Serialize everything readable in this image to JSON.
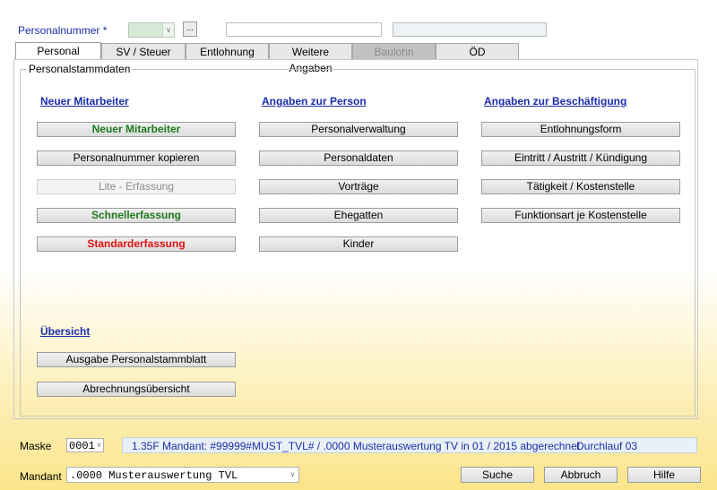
{
  "header": {
    "personalnummer_label": "Personalnummer *",
    "dots_label": "..."
  },
  "tabs": [
    {
      "label": "Personal",
      "state": "active"
    },
    {
      "label": "SV / Steuer",
      "state": "normal"
    },
    {
      "label": "Entlohnung",
      "state": "normal"
    },
    {
      "label": "Weitere Angaben",
      "state": "normal"
    },
    {
      "label": "Baulohn",
      "state": "disabled"
    },
    {
      "label": "ÖD",
      "state": "normal"
    }
  ],
  "group_title": "Personalstammdaten",
  "sections": {
    "neuer": {
      "heading": "Neuer Mitarbeiter",
      "buttons": [
        {
          "label": "Neuer Mitarbeiter"
        },
        {
          "label": "Personalnummer kopieren"
        },
        {
          "label": "Lite - Erfassung"
        },
        {
          "label": "Schnellerfassung"
        },
        {
          "label": "Standarderfassung"
        }
      ]
    },
    "person": {
      "heading": "Angaben zur Person",
      "buttons": [
        {
          "label": "Personalverwaltung"
        },
        {
          "label": "Personaldaten"
        },
        {
          "label": "Vorträge"
        },
        {
          "label": "Ehegatten"
        },
        {
          "label": "Kinder"
        }
      ]
    },
    "beschaeftigung": {
      "heading": "Angaben zur Beschäftigung",
      "buttons": [
        {
          "label": "Entlohnungsform"
        },
        {
          "label": "Eintritt / Austritt / Kündigung"
        },
        {
          "label": "Tätigkeit / Kostenstelle"
        },
        {
          "label": "Funktionsart je Kostenstelle"
        }
      ]
    },
    "uebersicht": {
      "heading": "Übersicht",
      "buttons": [
        {
          "label": "Ausgabe Personalstammblatt"
        },
        {
          "label": "Abrechnungsübersicht"
        }
      ]
    }
  },
  "footer": {
    "maske_label": "Maske",
    "maske_value": "0001",
    "status_text": "1.35F Mandant: #99999#MUST_TVL# / .0000 Musterauswertung TV in 01 / 2015 abgerechnet",
    "status_run": "Durchlauf 03",
    "mandant_label": "Mandant",
    "mandant_value": ".0000 Musterauswertung TVL",
    "buttons": {
      "suche": "Suche",
      "abbruch": "Abbruch",
      "hilfe": "Hilfe"
    }
  },
  "colors": {
    "accent_blue": "#1a2ea8",
    "green_text": "#1e7a1e",
    "red_text": "#e01010",
    "bg_yellow": "#fbe58a"
  }
}
